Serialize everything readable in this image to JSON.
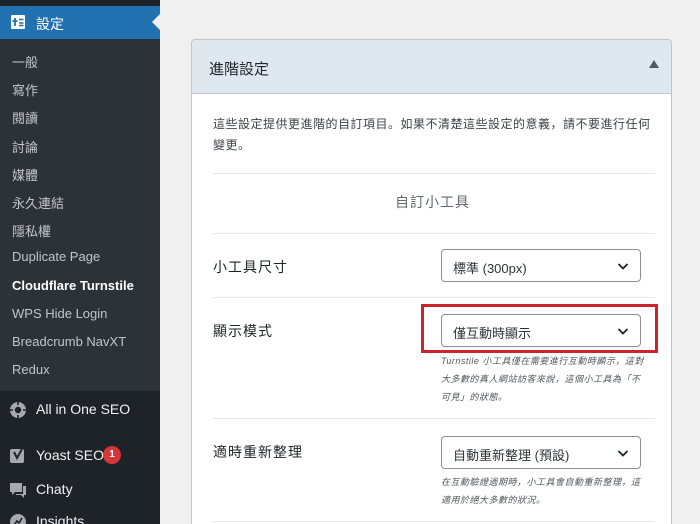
{
  "sidebar": {
    "current": {
      "label": "設定",
      "icon": "settings-plus-icon"
    },
    "submenu": [
      {
        "label": "一般",
        "active": false
      },
      {
        "label": "寫作",
        "active": false
      },
      {
        "label": "閱讀",
        "active": false
      },
      {
        "label": "討論",
        "active": false
      },
      {
        "label": "媒體",
        "active": false
      },
      {
        "label": "永久連結",
        "active": false
      },
      {
        "label": "隱私權",
        "active": false
      },
      {
        "label": "Duplicate Page",
        "active": false
      },
      {
        "label": "Cloudflare Turnstile",
        "active": true
      },
      {
        "label": "WPS Hide Login",
        "active": false
      },
      {
        "label": "Breadcrumb NavXT",
        "active": false
      },
      {
        "label": "Redux",
        "active": false
      }
    ],
    "items": [
      {
        "label": "All in One SEO",
        "icon": "aioseo-icon"
      },
      {
        "label": "Yoast SEO",
        "icon": "yoast-icon",
        "badge": "1"
      },
      {
        "label": "Chaty",
        "icon": "chat-bubble-icon"
      },
      {
        "label": "Insights",
        "icon": "insights-icon"
      }
    ]
  },
  "panel": {
    "title": "進階設定",
    "description": "這些設定提供更進階的自訂項目。如果不清楚這些設定的意義，請不要進行任何變更。",
    "section_heading": "自訂小工具",
    "rows": [
      {
        "label": "小工具尺寸",
        "value": "標準 (300px)",
        "hint": ""
      },
      {
        "label": "顯示模式",
        "value": "僅互動時顯示",
        "hint": "Turnstile 小工具僅在需要進行互動時顯示，這對大多數的真人網站訪客來說，這個小工具為「不可見」的狀態。"
      },
      {
        "label": "適時重新整理",
        "value": "自動重新整理 (預設)",
        "hint": "在互動驗證過期時，小工具會自動重新整理，這適用於絕大多數的狀況。"
      }
    ]
  },
  "colors": {
    "accent": "#2271b1",
    "highlight": "#d0222a",
    "sidebar": "#1d2327"
  }
}
